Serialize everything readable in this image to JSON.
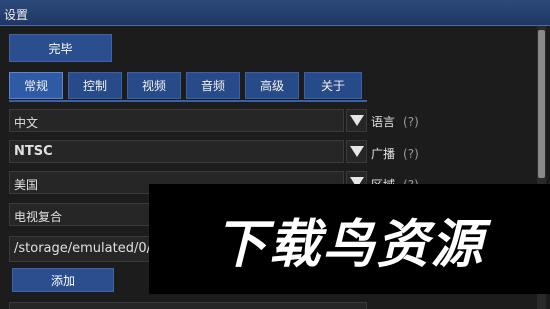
{
  "window": {
    "title": "设置"
  },
  "actions": {
    "done_label": "完毕",
    "add_label": "添加"
  },
  "tabs": [
    {
      "label": "常规",
      "active": true
    },
    {
      "label": "控制",
      "active": false
    },
    {
      "label": "视频",
      "active": false
    },
    {
      "label": "音频",
      "active": false
    },
    {
      "label": "高级",
      "active": false
    },
    {
      "label": "关于",
      "active": false
    }
  ],
  "settings": [
    {
      "value": "中文",
      "label": "语言",
      "help": "(?)"
    },
    {
      "value": "NTSC",
      "label": "广播",
      "help": "(?)"
    },
    {
      "value": "美国",
      "label": "区域",
      "help": "(?)"
    },
    {
      "value": "电视复合",
      "label": "",
      "help": ""
    }
  ],
  "path": {
    "value": "/storage/emulated/0/"
  },
  "watermark": {
    "text": "下载鸟资源"
  },
  "colors": {
    "accent": "#2a4e8e",
    "titlebar": "#1f3764",
    "background": "#1c1c1c"
  }
}
